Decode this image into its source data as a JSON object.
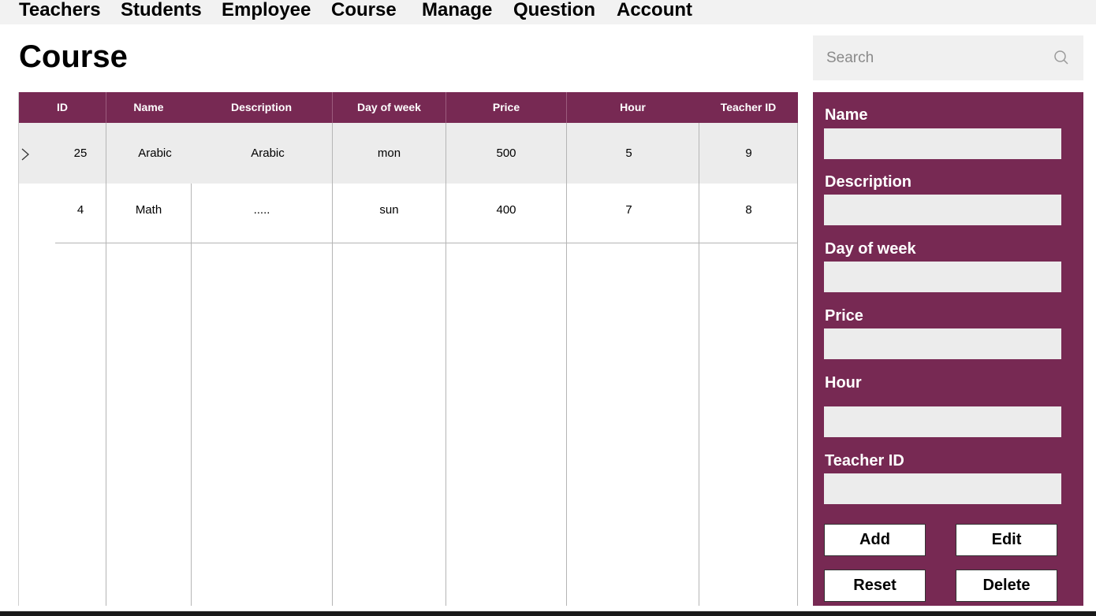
{
  "nav": {
    "items": [
      "Teachers",
      "Students",
      "Employee",
      "Course",
      "Manage",
      "Question",
      "Account"
    ]
  },
  "page": {
    "title": "Course"
  },
  "search": {
    "placeholder": "Search",
    "icon": "search-icon"
  },
  "table": {
    "columns": [
      "ID",
      "Name",
      "Description",
      "Day of week",
      "Price",
      "Hour",
      "Teacher ID"
    ],
    "rows": [
      {
        "id": "25",
        "name": "Arabic",
        "description": "Arabic",
        "day": "mon",
        "price": "500",
        "hour": "5",
        "teacher_id": "9"
      },
      {
        "id": "4",
        "name": "Math",
        "description": ".....",
        "day": "sun",
        "price": "400",
        "hour": "7",
        "teacher_id": "8"
      }
    ],
    "selected_row_indicator": ">"
  },
  "form": {
    "labels": {
      "name": "Name",
      "description": "Description",
      "day": "Day of week",
      "price": "Price",
      "hour": "Hour",
      "teacher_id": "Teacher ID"
    },
    "values": {
      "name": "",
      "description": "",
      "day": "",
      "price": "",
      "hour": "",
      "teacher_id": ""
    },
    "buttons": {
      "add": "Add",
      "edit": "Edit",
      "reset": "Reset",
      "delete": "Delete"
    }
  },
  "colors": {
    "accent": "#772953",
    "nav_bg": "#f2f2f2",
    "field_bg": "#ececec",
    "selected_row": "#ececec"
  }
}
